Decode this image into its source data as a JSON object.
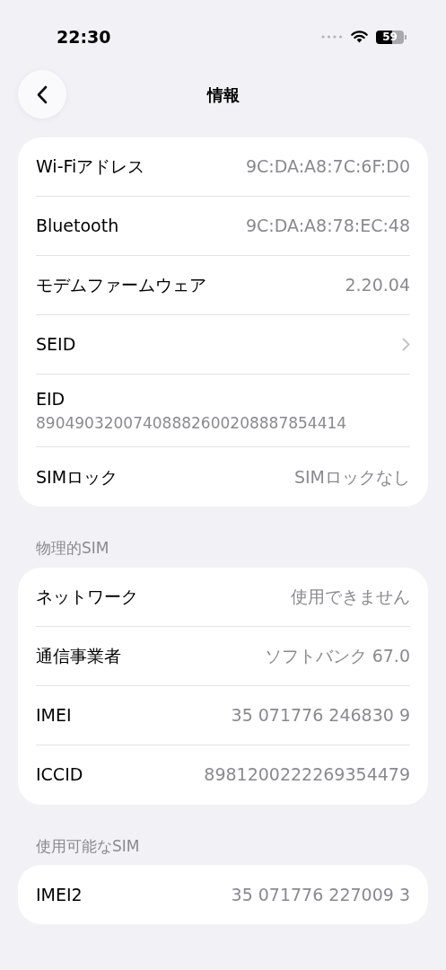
{
  "status_bar": {
    "time": "22:30",
    "battery": "59"
  },
  "nav": {
    "title": "情報"
  },
  "sections": [
    {
      "rows": [
        {
          "kind": "value",
          "label": "Wi-Fiアドレス",
          "value": "9C:DA:A8:7C:6F:D0"
        },
        {
          "kind": "value",
          "label": "Bluetooth",
          "value": "9C:DA:A8:78:EC:48"
        },
        {
          "kind": "value",
          "label": "モデムファームウェア",
          "value": "2.20.04"
        },
        {
          "kind": "link",
          "label": "SEID"
        },
        {
          "kind": "stacked",
          "label": "EID",
          "value": "89049032007408882600208887854414"
        },
        {
          "kind": "value",
          "label": "SIMロック",
          "value": "SIMロックなし"
        }
      ]
    },
    {
      "header": "物理的SIM",
      "rows": [
        {
          "kind": "value",
          "label": "ネットワーク",
          "value": "使用できません"
        },
        {
          "kind": "value",
          "label": "通信事業者",
          "value": "ソフトバンク 67.0"
        },
        {
          "kind": "value",
          "label": "IMEI",
          "value": "35 071776 246830 9"
        },
        {
          "kind": "value",
          "label": "ICCID",
          "value": "8981200222269354479"
        }
      ]
    },
    {
      "header": "使用可能なSIM",
      "rows": [
        {
          "kind": "value",
          "label": "IMEI2",
          "value": "35 071776 227009 3"
        }
      ]
    }
  ]
}
